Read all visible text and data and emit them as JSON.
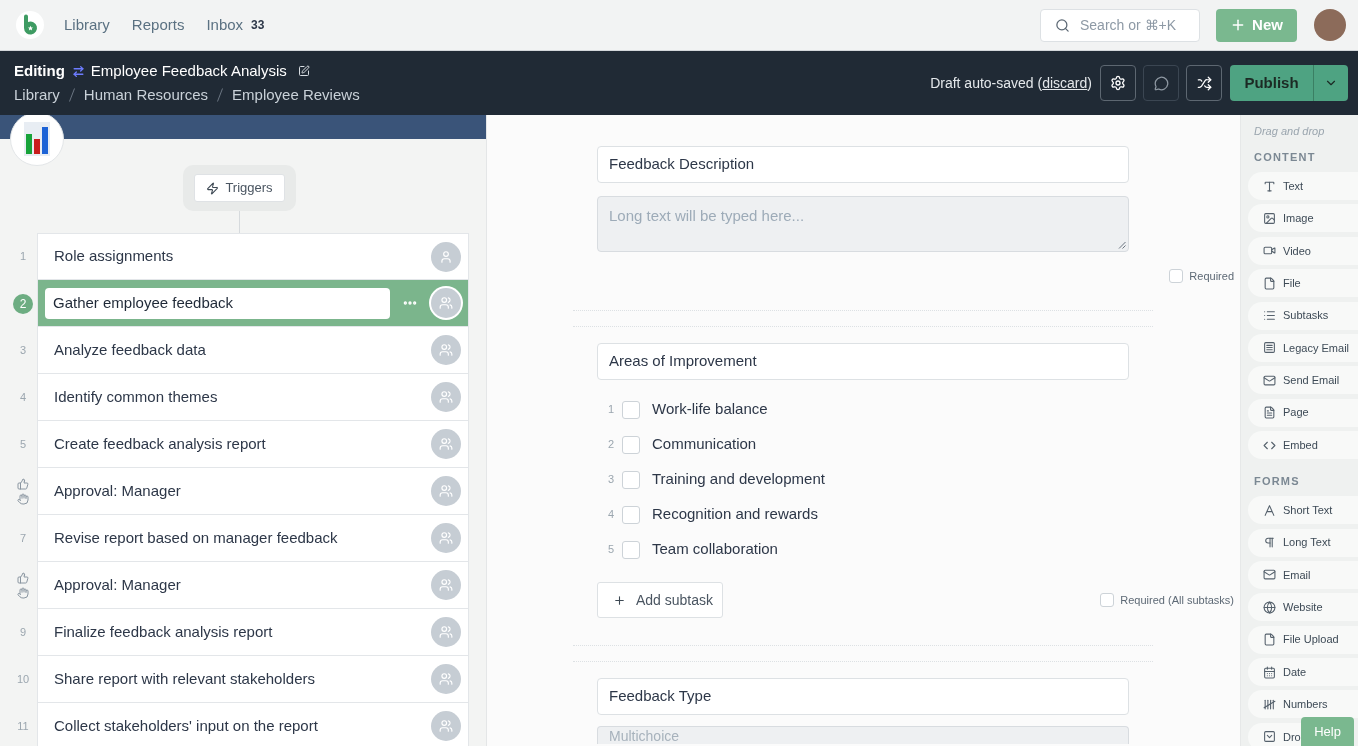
{
  "top_nav": {
    "links": [
      {
        "label": "Library"
      },
      {
        "label": "Reports"
      },
      {
        "label": "Inbox",
        "badge": "33"
      }
    ],
    "search": {
      "placeholder": "Search or ⌘+K"
    },
    "new_button": "New"
  },
  "editor_header": {
    "mode": "Editing",
    "title": "Employee Feedback Analysis",
    "breadcrumb": [
      "Library",
      "Human Resources",
      "Employee Reviews"
    ],
    "save_status": {
      "before": "Draft auto-saved (",
      "link": "discard",
      "after": ")"
    },
    "publish_button": "Publish"
  },
  "workflow": {
    "triggers_button": "Triggers",
    "tasks": [
      {
        "kind": "task",
        "number": "1",
        "title": "Role assignments",
        "assignee": {
          "kind": "single"
        },
        "selected": false
      },
      {
        "kind": "task",
        "number": "2",
        "title": "Gather employee feedback",
        "assignee": {
          "kind": "group"
        },
        "selected": true
      },
      {
        "kind": "task",
        "number": "3",
        "title": "Analyze feedback data",
        "assignee": {
          "kind": "group"
        },
        "selected": false
      },
      {
        "kind": "task",
        "number": "4",
        "title": "Identify common themes",
        "assignee": {
          "kind": "group"
        },
        "selected": false
      },
      {
        "kind": "task",
        "number": "5",
        "title": "Create feedback analysis report",
        "assignee": {
          "kind": "group"
        },
        "selected": false
      },
      {
        "kind": "approval",
        "title": "Approval: Manager",
        "assignee": {
          "kind": "group"
        },
        "selected": false
      },
      {
        "kind": "task",
        "number": "7",
        "title": "Revise report based on manager feedback",
        "assignee": {
          "kind": "group"
        },
        "selected": false
      },
      {
        "kind": "approval",
        "title": "Approval: Manager",
        "assignee": {
          "kind": "group"
        },
        "selected": false
      },
      {
        "kind": "task",
        "number": "9",
        "title": "Finalize feedback analysis report",
        "assignee": {
          "kind": "group"
        },
        "selected": false
      },
      {
        "kind": "task",
        "number": "10",
        "title": "Share report with relevant stakeholders",
        "assignee": {
          "kind": "group"
        },
        "selected": false
      },
      {
        "kind": "task",
        "number": "11",
        "title": "Collect stakeholders' input on the report",
        "assignee": {
          "kind": "group"
        },
        "selected": false
      }
    ]
  },
  "form": {
    "widgets": [
      {
        "kind": "long_text",
        "label": "Feedback Description",
        "placeholder": "Long text will be typed here...",
        "required_label": "Required",
        "required": false
      },
      {
        "kind": "subtasks",
        "label": "Areas of Improvement",
        "subtasks": [
          {
            "number": "1",
            "label": "Work-life balance",
            "checked": false
          },
          {
            "number": "2",
            "label": "Communication",
            "checked": false
          },
          {
            "number": "3",
            "label": "Training and development",
            "checked": false
          },
          {
            "number": "4",
            "label": "Recognition and rewards",
            "checked": false
          },
          {
            "number": "5",
            "label": "Team collaboration",
            "checked": false
          }
        ],
        "add_button": "Add subtask",
        "required_label": "Required (All subtasks)",
        "required": false
      },
      {
        "kind": "multichoice",
        "label": "Feedback Type",
        "placeholder": "Multichoice"
      }
    ]
  },
  "palette": {
    "hint": "Drag and drop",
    "sections": [
      {
        "title": "CONTENT",
        "items": [
          {
            "label": "Text"
          },
          {
            "label": "Image"
          },
          {
            "label": "Video"
          },
          {
            "label": "File"
          },
          {
            "label": "Subtasks"
          },
          {
            "label": "Legacy Email"
          },
          {
            "label": "Send Email"
          },
          {
            "label": "Page"
          },
          {
            "label": "Embed"
          }
        ]
      },
      {
        "title": "FORMS",
        "items": [
          {
            "label": "Short Text"
          },
          {
            "label": "Long Text"
          },
          {
            "label": "Email"
          },
          {
            "label": "Website"
          },
          {
            "label": "File Upload"
          },
          {
            "label": "Date"
          },
          {
            "label": "Numbers"
          },
          {
            "label": "Dro"
          }
        ]
      }
    ]
  },
  "help_button": "Help"
}
